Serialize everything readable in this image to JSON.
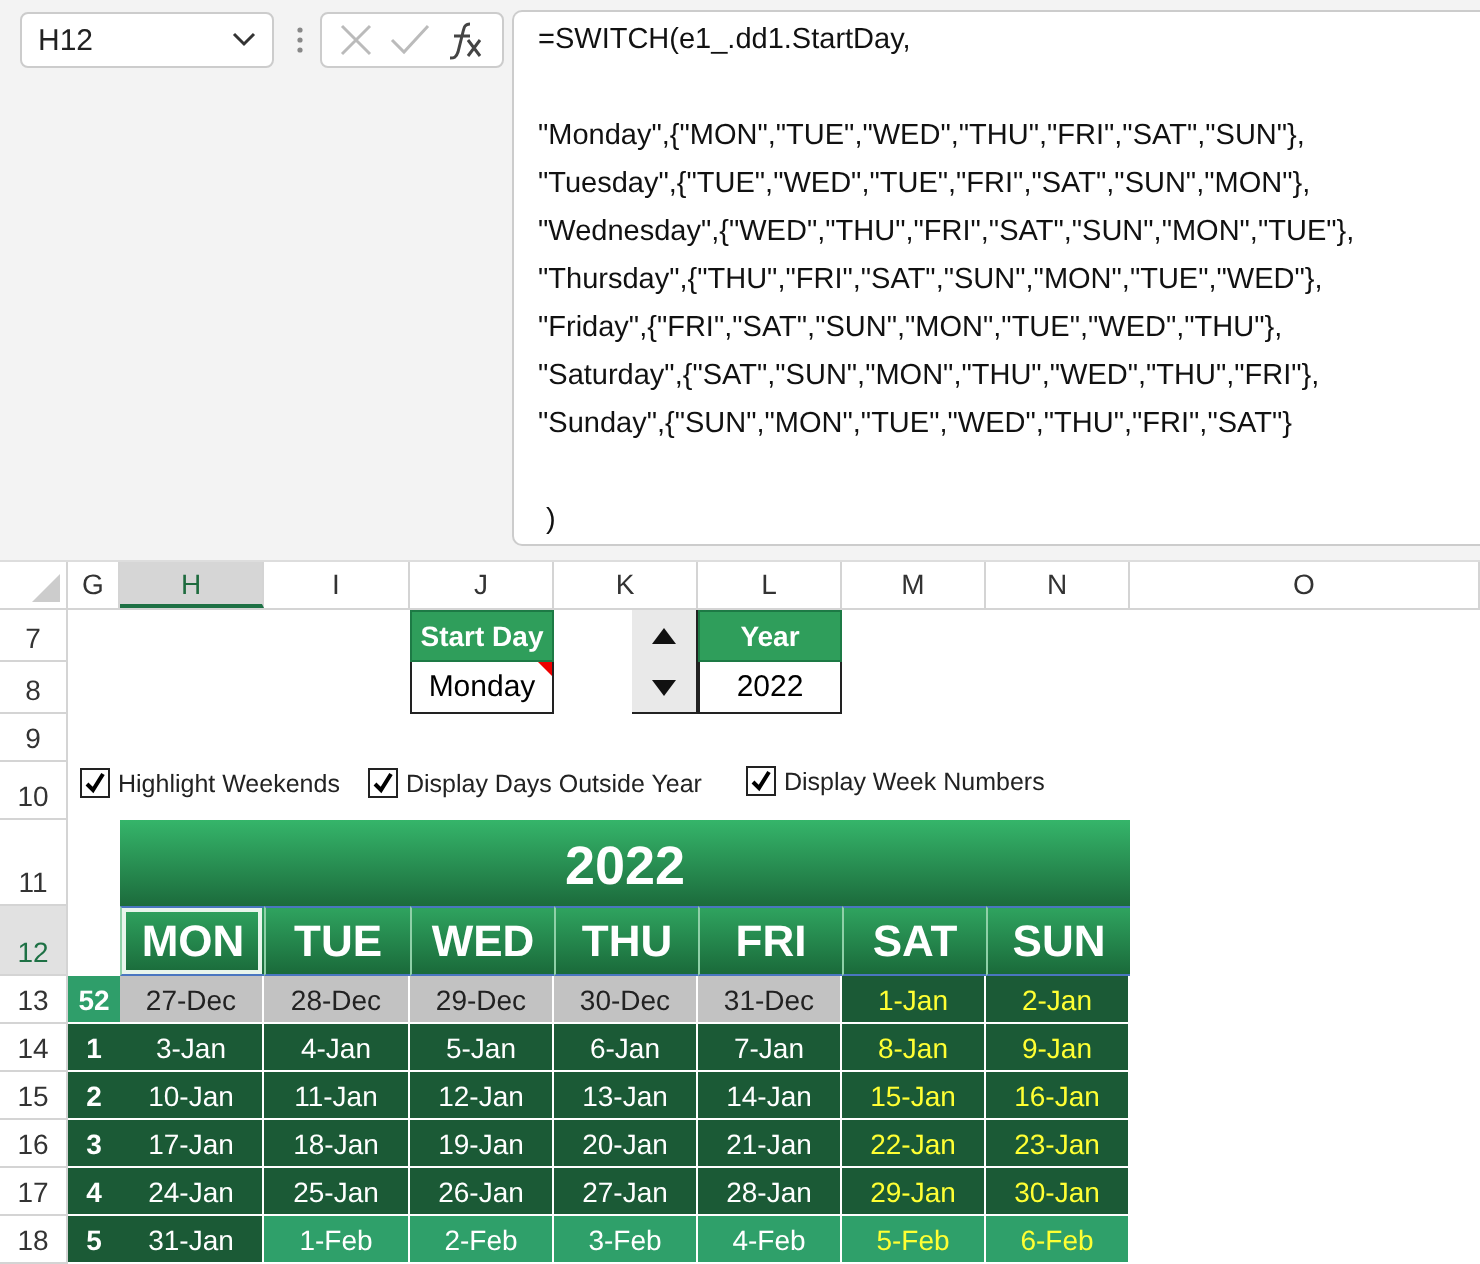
{
  "formula_bar": {
    "name_box": "H12",
    "formula": "=SWITCH(e1_.dd1.StartDay,\n\n\"Monday\",{\"MON\",\"TUE\",\"WED\",\"THU\",\"FRI\",\"SAT\",\"SUN\"},\n\"Tuesday\",{\"TUE\",\"WED\",\"TUE\",\"FRI\",\"SAT\",\"SUN\",\"MON\"},\n\"Wednesday\",{\"WED\",\"THU\",\"FRI\",\"SAT\",\"SUN\",\"MON\",\"TUE\"},\n\"Thursday\",{\"THU\",\"FRI\",\"SAT\",\"SUN\",\"MON\",\"TUE\",\"WED\"},\n\"Friday\",{\"FRI\",\"SAT\",\"SUN\",\"MON\",\"TUE\",\"WED\",\"THU\"},\n\"Saturday\",{\"SAT\",\"SUN\",\"MON\",\"THU\",\"WED\",\"THU\",\"FRI\"},\n\"Sunday\",{\"SUN\",\"MON\",\"TUE\",\"WED\",\"THU\",\"FRI\",\"SAT\"}\n\n )"
  },
  "columns": [
    {
      "label": "G",
      "selected": false
    },
    {
      "label": "H",
      "selected": true
    },
    {
      "label": "I",
      "selected": false
    },
    {
      "label": "J",
      "selected": false
    },
    {
      "label": "K",
      "selected": false
    },
    {
      "label": "L",
      "selected": false
    },
    {
      "label": "M",
      "selected": false
    },
    {
      "label": "N",
      "selected": false
    },
    {
      "label": "O",
      "selected": false
    }
  ],
  "rows": [
    {
      "label": "7",
      "selected": false
    },
    {
      "label": "8",
      "selected": false
    },
    {
      "label": "9",
      "selected": false
    },
    {
      "label": "10",
      "selected": false
    },
    {
      "label": "11",
      "selected": false
    },
    {
      "label": "12",
      "selected": true
    },
    {
      "label": "13",
      "selected": false
    },
    {
      "label": "14",
      "selected": false
    },
    {
      "label": "15",
      "selected": false
    },
    {
      "label": "16",
      "selected": false
    },
    {
      "label": "17",
      "selected": false
    },
    {
      "label": "18",
      "selected": false
    }
  ],
  "start_day": {
    "label": "Start Day",
    "value": "Monday"
  },
  "year": {
    "label": "Year",
    "value": "2022"
  },
  "options": [
    {
      "label": "Highlight Weekends",
      "checked": true
    },
    {
      "label": "Display Days Outside Year",
      "checked": true
    },
    {
      "label": "Display Week Numbers",
      "checked": true
    }
  ],
  "calendar": {
    "title": "2022",
    "days": [
      {
        "label": "MON",
        "selected": true
      },
      {
        "label": "TUE",
        "selected": false
      },
      {
        "label": "WED",
        "selected": false
      },
      {
        "label": "THU",
        "selected": false
      },
      {
        "label": "FRI",
        "selected": false
      },
      {
        "label": "SAT",
        "selected": false
      },
      {
        "label": "SUN",
        "selected": false
      }
    ],
    "weeks": [
      {
        "number": "52",
        "kind": "previous",
        "days": [
          {
            "date": "27-Dec",
            "kind": "outside",
            "weekend": false
          },
          {
            "date": "28-Dec",
            "kind": "outside",
            "weekend": false
          },
          {
            "date": "29-Dec",
            "kind": "outside",
            "weekend": false
          },
          {
            "date": "30-Dec",
            "kind": "outside",
            "weekend": false
          },
          {
            "date": "31-Dec",
            "kind": "outside",
            "weekend": false
          },
          {
            "date": "1-Jan",
            "kind": "current",
            "weekend": true
          },
          {
            "date": "2-Jan",
            "kind": "current",
            "weekend": true
          }
        ]
      },
      {
        "number": "1",
        "kind": "current",
        "days": [
          {
            "date": "3-Jan",
            "kind": "current",
            "weekend": false
          },
          {
            "date": "4-Jan",
            "kind": "current",
            "weekend": false
          },
          {
            "date": "5-Jan",
            "kind": "current",
            "weekend": false
          },
          {
            "date": "6-Jan",
            "kind": "current",
            "weekend": false
          },
          {
            "date": "7-Jan",
            "kind": "current",
            "weekend": false
          },
          {
            "date": "8-Jan",
            "kind": "current",
            "weekend": true
          },
          {
            "date": "9-Jan",
            "kind": "current",
            "weekend": true
          }
        ]
      },
      {
        "number": "2",
        "kind": "current",
        "days": [
          {
            "date": "10-Jan",
            "kind": "current",
            "weekend": false
          },
          {
            "date": "11-Jan",
            "kind": "current",
            "weekend": false
          },
          {
            "date": "12-Jan",
            "kind": "current",
            "weekend": false
          },
          {
            "date": "13-Jan",
            "kind": "current",
            "weekend": false
          },
          {
            "date": "14-Jan",
            "kind": "current",
            "weekend": false
          },
          {
            "date": "15-Jan",
            "kind": "current",
            "weekend": true
          },
          {
            "date": "16-Jan",
            "kind": "current",
            "weekend": true
          }
        ]
      },
      {
        "number": "3",
        "kind": "current",
        "days": [
          {
            "date": "17-Jan",
            "kind": "current",
            "weekend": false
          },
          {
            "date": "18-Jan",
            "kind": "current",
            "weekend": false
          },
          {
            "date": "19-Jan",
            "kind": "current",
            "weekend": false
          },
          {
            "date": "20-Jan",
            "kind": "current",
            "weekend": false
          },
          {
            "date": "21-Jan",
            "kind": "current",
            "weekend": false
          },
          {
            "date": "22-Jan",
            "kind": "current",
            "weekend": true
          },
          {
            "date": "23-Jan",
            "kind": "current",
            "weekend": true
          }
        ]
      },
      {
        "number": "4",
        "kind": "current",
        "days": [
          {
            "date": "24-Jan",
            "kind": "current",
            "weekend": false
          },
          {
            "date": "25-Jan",
            "kind": "current",
            "weekend": false
          },
          {
            "date": "26-Jan",
            "kind": "current",
            "weekend": false
          },
          {
            "date": "27-Jan",
            "kind": "current",
            "weekend": false
          },
          {
            "date": "28-Jan",
            "kind": "current",
            "weekend": false
          },
          {
            "date": "29-Jan",
            "kind": "current",
            "weekend": true
          },
          {
            "date": "30-Jan",
            "kind": "current",
            "weekend": true
          }
        ]
      },
      {
        "number": "5",
        "kind": "current",
        "days": [
          {
            "date": "31-Jan",
            "kind": "current",
            "weekend": false
          },
          {
            "date": "1-Feb",
            "kind": "next",
            "weekend": false
          },
          {
            "date": "2-Feb",
            "kind": "next",
            "weekend": false
          },
          {
            "date": "3-Feb",
            "kind": "next",
            "weekend": false
          },
          {
            "date": "4-Feb",
            "kind": "next",
            "weekend": false
          },
          {
            "date": "5-Feb",
            "kind": "next",
            "weekend": true
          },
          {
            "date": "6-Feb",
            "kind": "next",
            "weekend": true
          }
        ]
      }
    ]
  }
}
